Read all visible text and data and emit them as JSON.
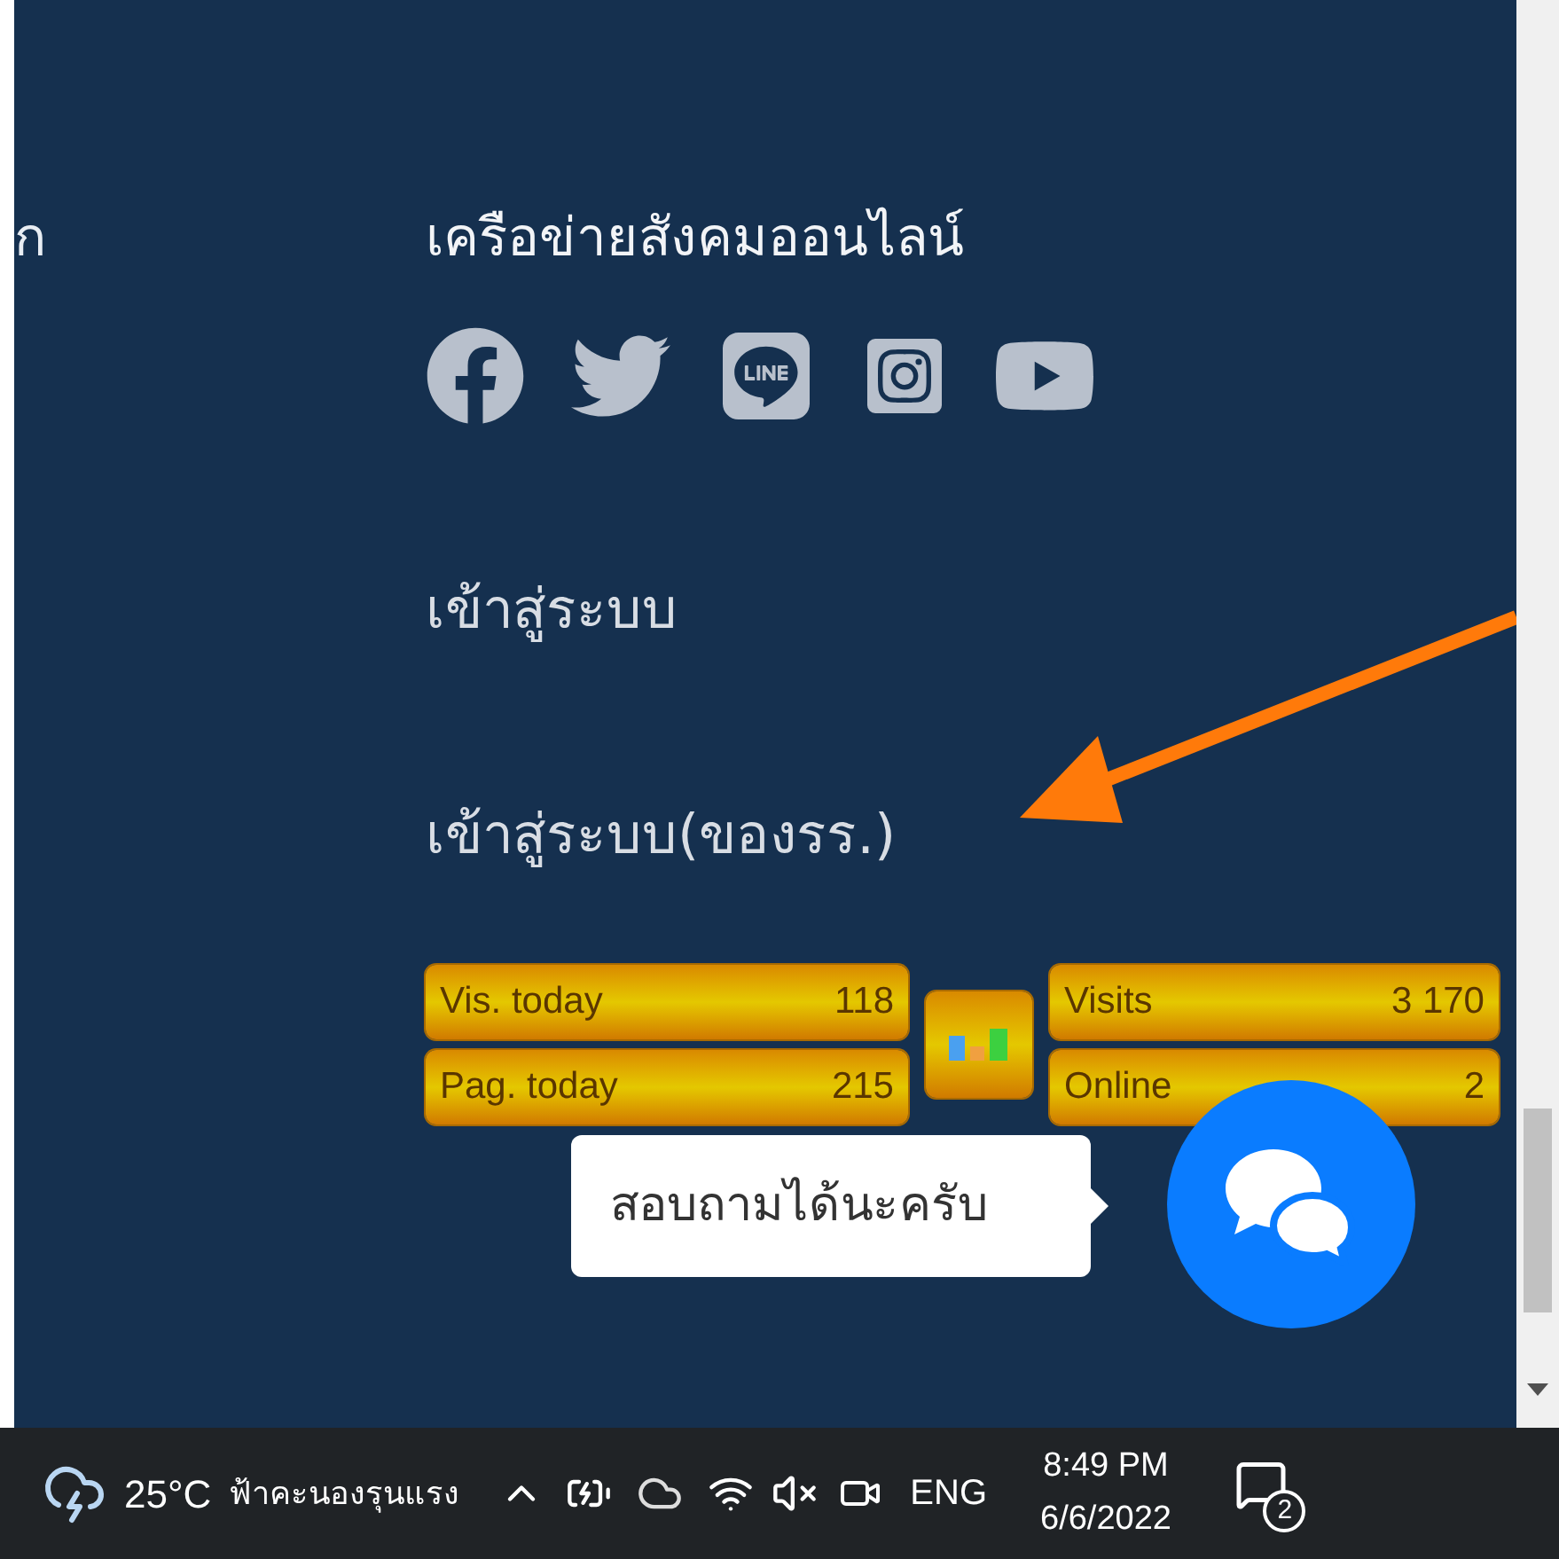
{
  "left_fragment": "ก",
  "social": {
    "heading": "เครือข่ายสังคมออนไลน์"
  },
  "links": [
    {
      "label": "เข้าสู่ระบบ"
    },
    {
      "label": "เข้าสู่ระบบ(ของรร.)"
    }
  ],
  "counter": {
    "left": [
      {
        "label": "Vis. today",
        "value": "118"
      },
      {
        "label": "Pag. today",
        "value": "215"
      }
    ],
    "right": [
      {
        "label": "Visits",
        "value": "3 170"
      },
      {
        "label": "Online",
        "value": "2"
      }
    ]
  },
  "chat": {
    "tooltip": "สอบถามได้นะครับ"
  },
  "taskbar": {
    "temperature": "25°C",
    "weather": "ฟ้าคะนองรุนแรง",
    "language": "ENG",
    "time": "8:49 PM",
    "date": "6/6/2022",
    "notification_count": "2"
  }
}
